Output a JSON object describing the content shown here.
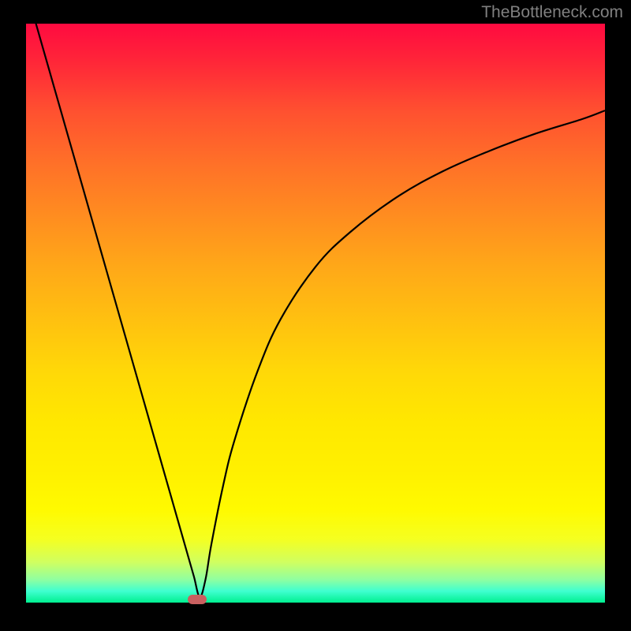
{
  "watermark": "TheBottleneck.com",
  "chart_data": {
    "type": "line",
    "title": "",
    "xlabel": "",
    "ylabel": "",
    "x": [
      0,
      2,
      4,
      6,
      8,
      10,
      12,
      14,
      16,
      18,
      20,
      22,
      24,
      26,
      28,
      29,
      30,
      31,
      32,
      34,
      36,
      40,
      44,
      50,
      56,
      64,
      72,
      80,
      88,
      96,
      100
    ],
    "values": [
      106,
      99,
      92,
      85,
      78,
      71,
      64,
      57,
      50,
      43,
      36,
      29,
      22,
      15,
      8,
      4.5,
      1,
      4,
      10,
      20,
      28,
      40,
      49,
      58,
      64,
      70,
      74.5,
      78,
      81,
      83.5,
      85
    ],
    "xlim": [
      0,
      100
    ],
    "ylim": [
      0,
      100
    ],
    "marker": {
      "x": 29.5,
      "y": 0.5
    },
    "background_gradient": [
      "#ff0a40",
      "#00f090"
    ]
  }
}
